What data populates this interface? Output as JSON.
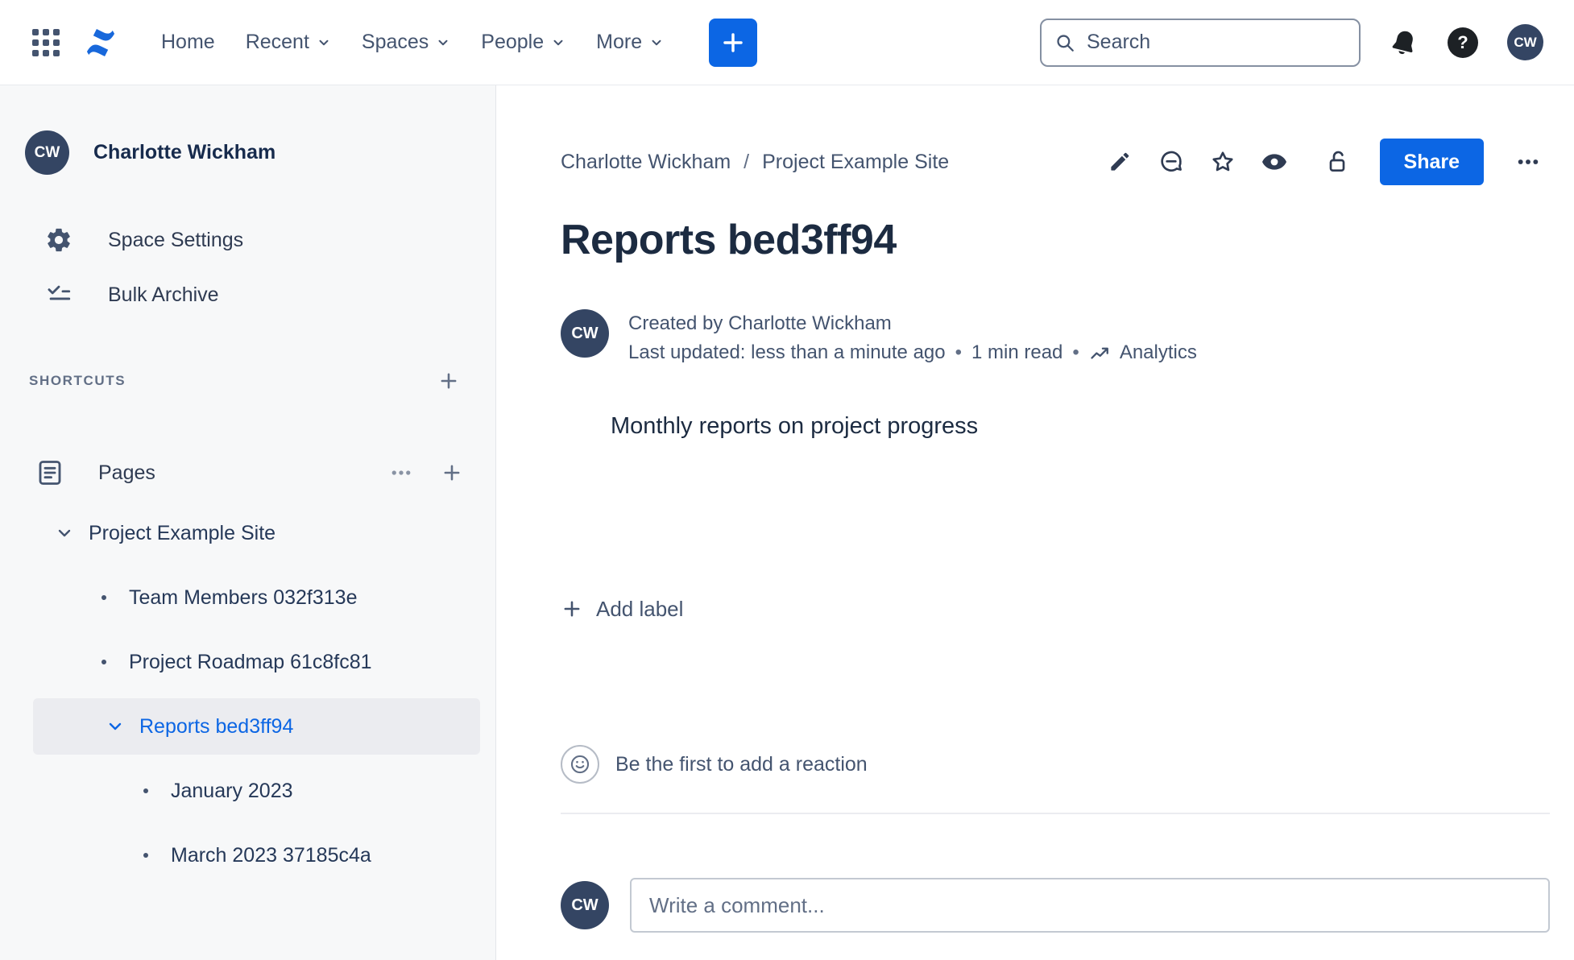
{
  "colors": {
    "accent_blue": "#0C66E4",
    "brand_blue": "#1868DB",
    "title_text": "#1C2B41",
    "muted_text": "#44546F",
    "sidebar_bg": "#F7F8F9",
    "selected_item_bg": "#EBECF0",
    "avatar_bg": "#344563"
  },
  "topbar": {
    "nav_items": [
      {
        "label": "Home",
        "chevron": false
      },
      {
        "label": "Recent",
        "chevron": true
      },
      {
        "label": "Spaces",
        "chevron": true
      },
      {
        "label": "People",
        "chevron": true
      },
      {
        "label": "More",
        "chevron": true
      }
    ],
    "search": {
      "placeholder": "Search"
    },
    "avatar_initials": "CW"
  },
  "sidebar": {
    "profile": {
      "name": "Charlotte Wickham",
      "avatar_initials": "CW"
    },
    "menu": [
      {
        "label": "Space Settings"
      },
      {
        "label": "Bulk Archive"
      }
    ],
    "shortcuts_header": "SHORTCUTS",
    "pages": {
      "label": "Pages"
    },
    "tree": {
      "root": {
        "label": "Project Example Site"
      },
      "items": [
        {
          "label": "Team Members 032f313e"
        },
        {
          "label": "Project Roadmap 61c8fc81"
        },
        {
          "label": "Reports bed3ff94",
          "selected": true
        },
        {
          "label": "January 2023"
        },
        {
          "label": "March 2023 37185c4a"
        }
      ]
    }
  },
  "main": {
    "breadcrumb": {
      "items": [
        "Charlotte Wickham",
        "Project Example Site"
      ],
      "separator": "/"
    },
    "actions": {
      "share_label": "Share"
    },
    "title": "Reports bed3ff94",
    "byline": {
      "avatar_initials": "CW",
      "created": "Created by Charlotte Wickham",
      "updated": "Last updated: less than a minute ago",
      "read_time": "1 min read",
      "analytics_label": "Analytics",
      "dot": "•"
    },
    "body_text": "Monthly reports on project progress",
    "labels": {
      "add_label": "Add label"
    },
    "reactions": {
      "prompt": "Be the first to add a reaction"
    },
    "comment": {
      "placeholder": "Write a comment...",
      "avatar_initials": "CW"
    }
  }
}
